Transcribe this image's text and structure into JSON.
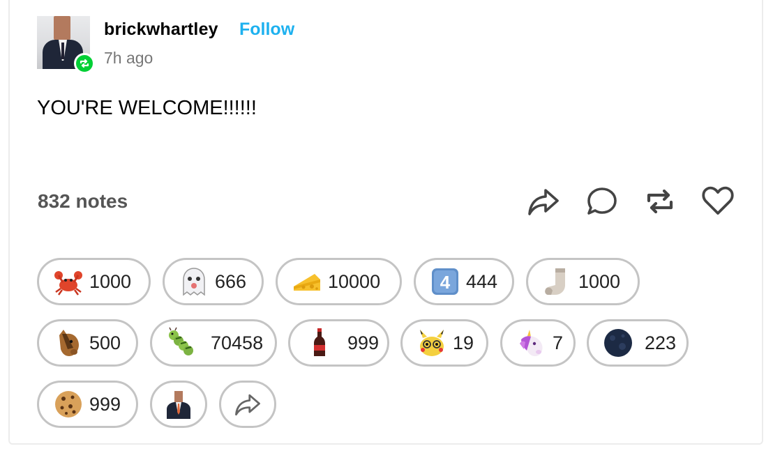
{
  "post": {
    "username": "brickwhartley",
    "follow_label": "Follow",
    "timestamp": "7h ago",
    "body_text": "YOU'RE WELCOME!!!!!!",
    "notes_label": "832 notes"
  },
  "actions": [
    "share-icon",
    "reply-icon",
    "reblog-icon",
    "like-icon"
  ],
  "reactions": [
    {
      "icon": "crab-icon",
      "count": "1000"
    },
    {
      "icon": "ghost-icon",
      "count": "666"
    },
    {
      "icon": "cheese-icon",
      "count": "10000"
    },
    {
      "icon": "keycap-4-icon",
      "count": "444"
    },
    {
      "icon": "sock-icon",
      "count": "1000"
    },
    {
      "icon": "horse-icon",
      "count": "500"
    },
    {
      "icon": "caterpillar-icon",
      "count": "70458"
    },
    {
      "icon": "soda-bottle-icon",
      "count": "999"
    },
    {
      "icon": "pikachu-icon",
      "count": "19"
    },
    {
      "icon": "unicorn-icon",
      "count": "7"
    },
    {
      "icon": "dark-moon-icon",
      "count": "223"
    },
    {
      "icon": "cookie-icon",
      "count": "999"
    },
    {
      "icon": "businessman-sticker-icon",
      "count": ""
    },
    {
      "icon": "share-icon",
      "count": ""
    }
  ],
  "keycap_label": "4",
  "colors": {
    "follow": "#1eb1ef",
    "reblog_badge": "#01cf35",
    "pill_border": "#c4c4c4",
    "notes_text": "#555555"
  }
}
